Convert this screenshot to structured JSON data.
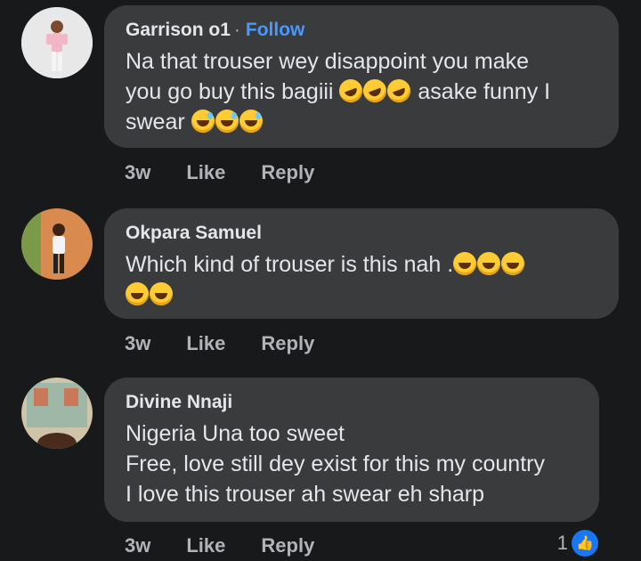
{
  "comments": [
    {
      "author": "Garrison o1",
      "separator": "·",
      "follow": "Follow",
      "lines": [
        "Na that trouser wey disappoint you make",
        "you go buy this bagiii",
        "asake funny I",
        "swear"
      ],
      "time": "3w",
      "like": "Like",
      "reply": "Reply",
      "avatar_icon": "person-standing-avatar"
    },
    {
      "author": "Okpara Samuel",
      "lines": [
        "Which kind of trouser is this nah ."
      ],
      "time": "3w",
      "like": "Like",
      "reply": "Reply",
      "avatar_icon": "person-standing-avatar"
    },
    {
      "author": "Divine Nnaji",
      "lines": [
        "Nigeria Una too sweet",
        "Free, love still dey exist for this my country",
        "I love this trouser ah swear eh sharp"
      ],
      "time": "3w",
      "like": "Like",
      "reply": "Reply",
      "reaction_count": "1",
      "reaction_icon": "thumbs-up-icon",
      "avatar_icon": "selfie-avatar"
    }
  ],
  "colors": {
    "background": "#18191a",
    "bubble": "#3a3b3c",
    "follow": "#4599ff",
    "meta": "#b0b3b8",
    "like_badge": "#1877f2"
  }
}
